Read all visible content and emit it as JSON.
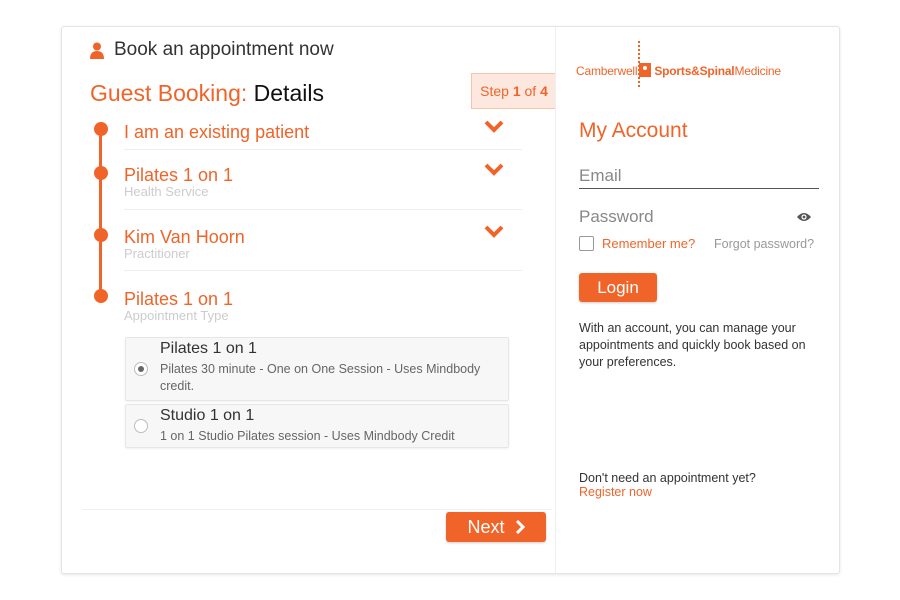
{
  "header": {
    "title": "Book an appointment now",
    "icon": "user-icon"
  },
  "booking": {
    "title_prefix": "Guest Booking:",
    "title_suffix": "Details"
  },
  "step_badge": {
    "word": "Step",
    "current": "1",
    "of": "of",
    "total": "4"
  },
  "steps": [
    {
      "title": "I am an existing patient",
      "subtitle": ""
    },
    {
      "title": "Pilates 1 on 1",
      "subtitle": "Health Service"
    },
    {
      "title": "Kim Van Hoorn",
      "subtitle": "Practitioner"
    },
    {
      "title": "Pilates 1 on 1",
      "subtitle": "Appointment Type"
    }
  ],
  "options": [
    {
      "title": "Pilates 1 on 1",
      "description": "Pilates 30 minute - One on One Session - Uses Mindbody credit.",
      "selected": true
    },
    {
      "title": "Studio 1 on 1",
      "description": "1 on 1 Studio Pilates session - Uses Mindbody Credit",
      "selected": false
    }
  ],
  "next_button": {
    "label": "Next"
  },
  "logo": {
    "part1": "Camberwell",
    "part2": "Sports&Spinal",
    "part3": "Medicine"
  },
  "account": {
    "title": "My Account",
    "email_placeholder": "Email",
    "password_placeholder": "Password",
    "remember_label": "Remember me?",
    "forgot_label": "Forgot password?",
    "login_label": "Login",
    "info_text": "With an account, you can manage your appointments and quickly book based on your preferences.",
    "no_need_text": "Don't need an appointment yet?",
    "register_label": "Register now"
  },
  "colors": {
    "accent": "#f0642a",
    "badge_bg": "#fde8df"
  }
}
